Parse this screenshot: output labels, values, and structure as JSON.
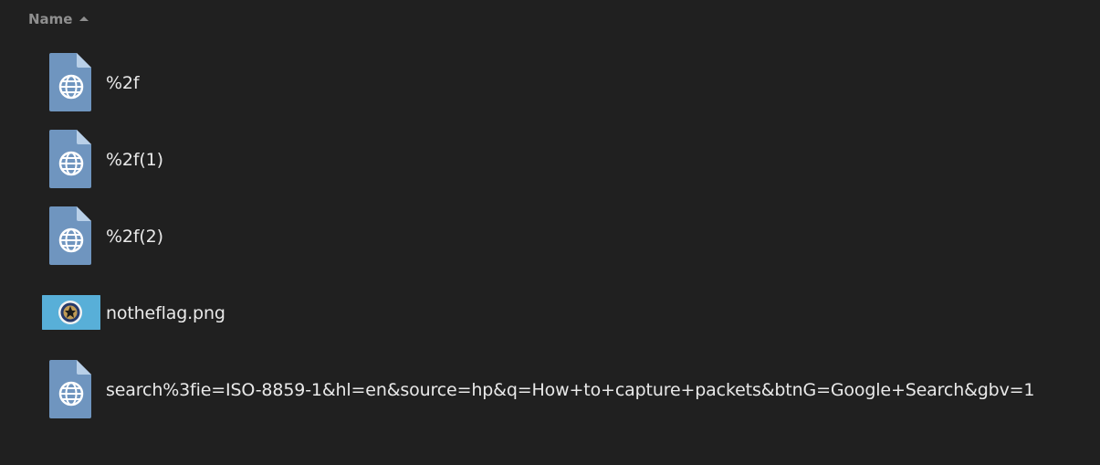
{
  "header": {
    "name_column": "Name",
    "sort_direction": "ascending"
  },
  "files": [
    {
      "name": "%2f",
      "icon": "html-document-icon"
    },
    {
      "name": "%2f(1)",
      "icon": "html-document-icon"
    },
    {
      "name": "%2f(2)",
      "icon": "html-document-icon"
    },
    {
      "name": "notheflag.png",
      "icon": "image-thumbnail-icon"
    },
    {
      "name": "search%3fie=ISO-8859-1&hl=en&source=hp&q=How+to+capture+packets&btnG=Google+Search&gbv=1",
      "icon": "html-document-icon"
    }
  ],
  "colors": {
    "background": "#202020",
    "header_text": "#8f8f8f",
    "file_text": "#e9e9e9",
    "document_icon": "#6f95bf",
    "thumbnail_background": "#58afd8"
  }
}
